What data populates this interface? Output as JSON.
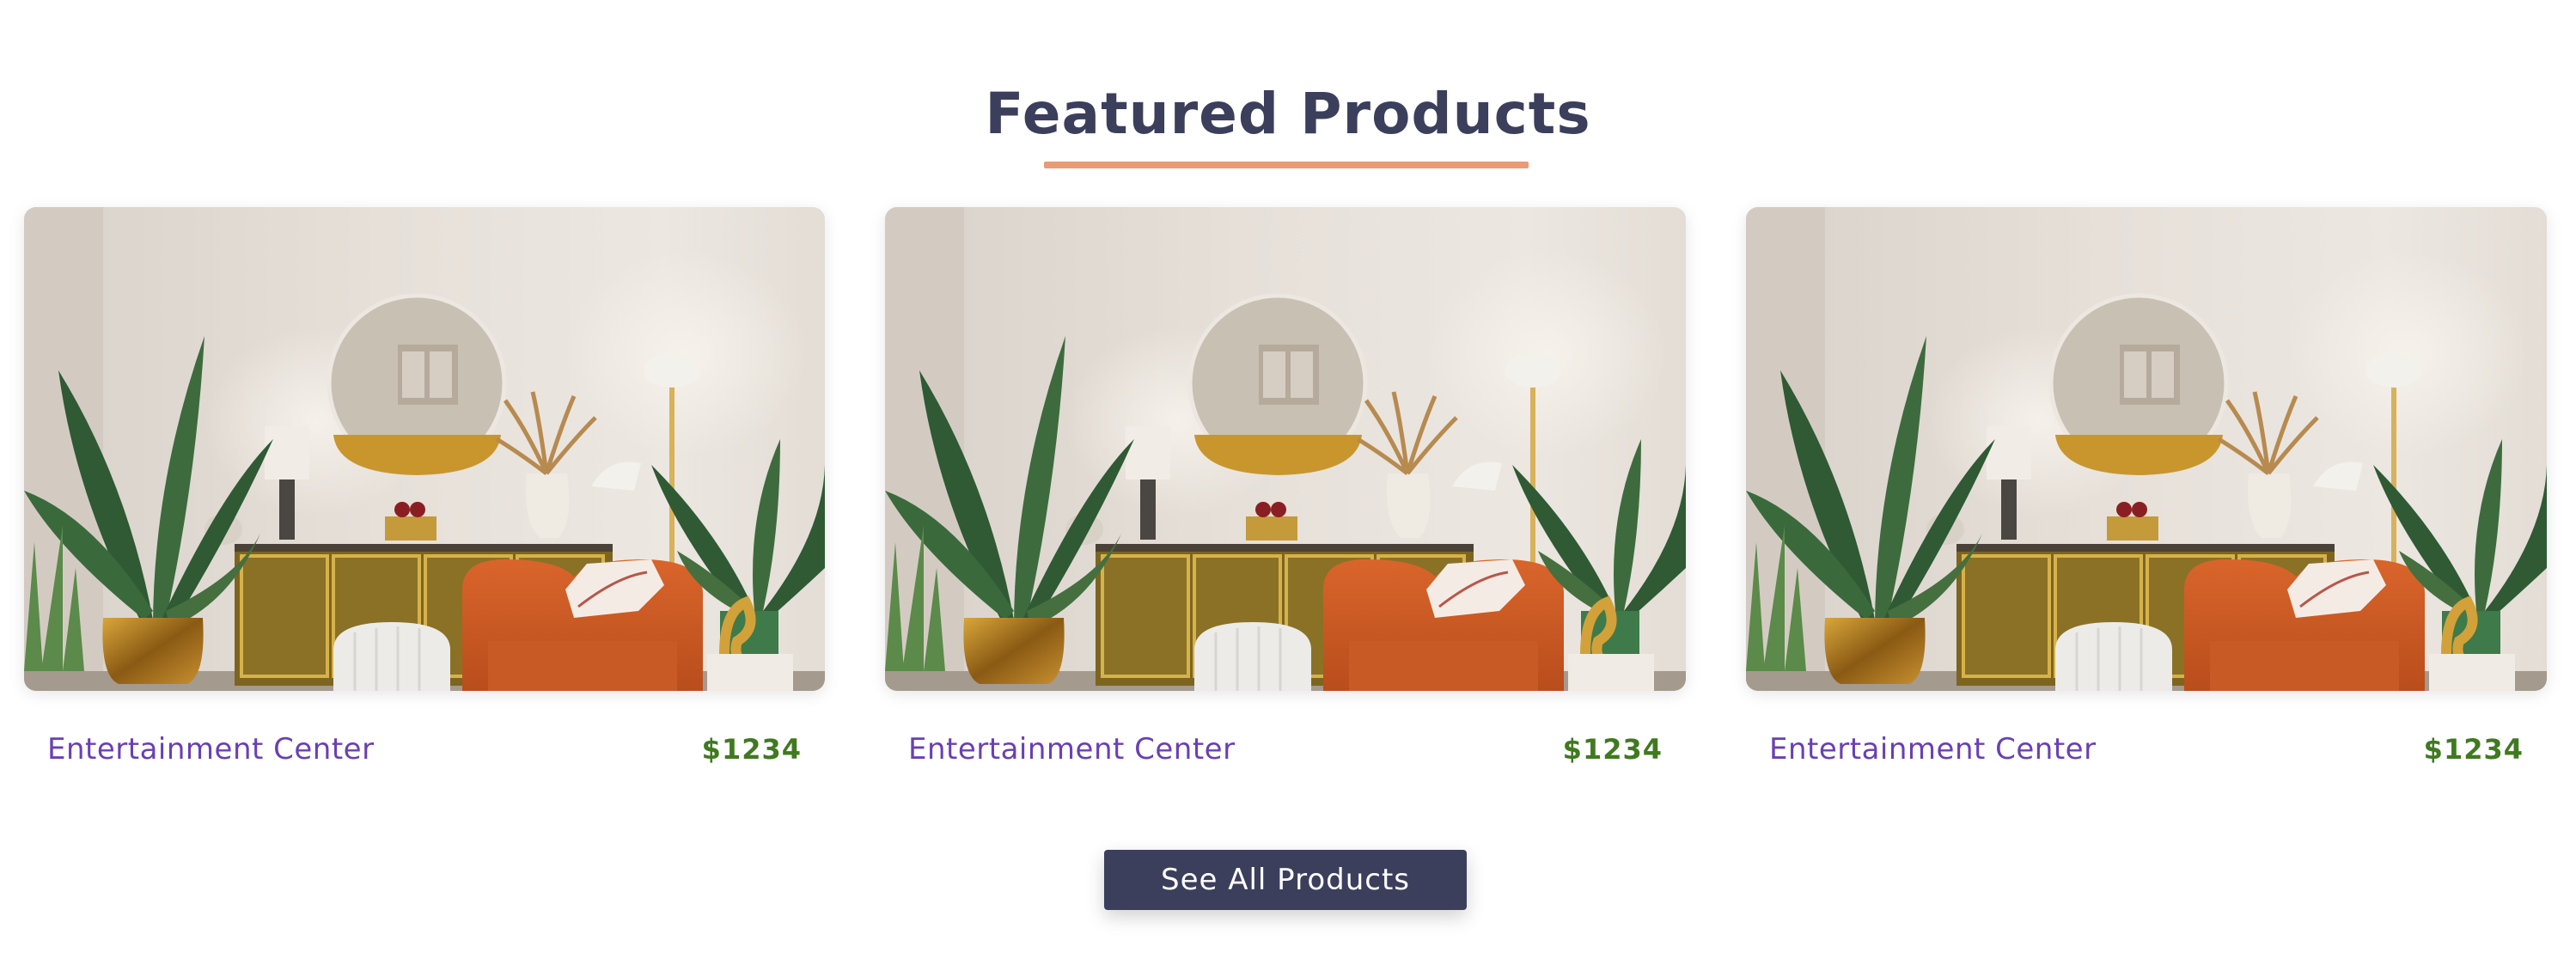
{
  "section": {
    "title": "Featured Products",
    "button_label": "See All Products"
  },
  "products": [
    {
      "name": "Entertainment Center",
      "price": "$1234",
      "image_icon": "living-room-photo"
    },
    {
      "name": "Entertainment Center",
      "price": "$1234",
      "image_icon": "living-room-photo"
    },
    {
      "name": "Entertainment Center",
      "price": "$1234",
      "image_icon": "living-room-photo"
    }
  ],
  "colors": {
    "title": "#3b3f5c",
    "underline": "#e89b74",
    "product_name": "#6a3fb5",
    "price": "#3f7a1f",
    "button_bg": "#3b3f5c",
    "button_text": "#ffffff"
  }
}
